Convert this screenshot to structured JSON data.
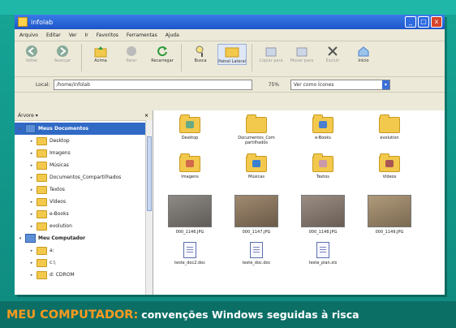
{
  "window": {
    "title": "infolab",
    "buttons": [
      "_",
      "□",
      "x"
    ]
  },
  "menubar": [
    "Arquivo",
    "Editar",
    "Ver",
    "Ir",
    "Favoritos",
    "Ferramentas",
    "Ajuda"
  ],
  "toolbar": [
    {
      "label": "Voltar",
      "icon": "back-arrow-icon",
      "dim": true
    },
    {
      "label": "Avançar",
      "icon": "forward-arrow-icon",
      "dim": true
    },
    {
      "label": "Acima",
      "icon": "up-folder-icon",
      "dim": false
    },
    {
      "label": "Parar",
      "icon": "stop-icon",
      "dim": true
    },
    {
      "label": "Recarregar",
      "icon": "reload-icon",
      "dim": false
    },
    {
      "label": "Busca",
      "icon": "search-icon",
      "dim": false
    },
    {
      "label": "Painel Lateral",
      "icon": "sidebar-icon",
      "dim": false
    },
    {
      "label": "Copiar para",
      "icon": "copy-icon",
      "dim": true
    },
    {
      "label": "Mover para",
      "icon": "move-icon",
      "dim": true
    },
    {
      "label": "Excluir",
      "icon": "delete-icon",
      "dim": true
    },
    {
      "label": "Início",
      "icon": "home-icon",
      "dim": false
    }
  ],
  "location": {
    "label": "Local:",
    "value": "/home/infolab",
    "zoom": "75%",
    "view": "Ver como Ícones"
  },
  "sidebar": {
    "title": "Árvore",
    "items": [
      {
        "label": "Meus Documentos",
        "indent": 0,
        "type": "pc",
        "selected": true
      },
      {
        "label": "Desktop",
        "indent": 1,
        "type": "folder"
      },
      {
        "label": "Imagens",
        "indent": 1,
        "type": "folder"
      },
      {
        "label": "Músicas",
        "indent": 1,
        "type": "folder"
      },
      {
        "label": "Documentos_Compartilhados",
        "indent": 1,
        "type": "folder"
      },
      {
        "label": "Textos",
        "indent": 1,
        "type": "folder"
      },
      {
        "label": "Vídeos",
        "indent": 1,
        "type": "folder"
      },
      {
        "label": "e-Books",
        "indent": 1,
        "type": "folder"
      },
      {
        "label": "evolution",
        "indent": 1,
        "type": "folder"
      },
      {
        "label": "Meu Computador",
        "indent": 0,
        "type": "pc"
      },
      {
        "label": "a:",
        "indent": 1,
        "type": "folder"
      },
      {
        "label": "c:\\",
        "indent": 1,
        "type": "folder"
      },
      {
        "label": "d: CDROM",
        "indent": 1,
        "type": "folder"
      }
    ]
  },
  "files": [
    {
      "label": "Desktop",
      "kind": "folder",
      "emblem": "#6a8"
    },
    {
      "label": "Documentos_Com partilhados",
      "kind": "folder",
      "emblem": ""
    },
    {
      "label": "e-Books",
      "kind": "folder",
      "emblem": "#4a7fd0"
    },
    {
      "label": "evolution",
      "kind": "folder",
      "emblem": ""
    },
    {
      "label": "Imagens",
      "kind": "folder",
      "emblem": "#d06a4a"
    },
    {
      "label": "Músicas",
      "kind": "folder",
      "emblem": "#3a7fd0"
    },
    {
      "label": "Textos",
      "kind": "folder",
      "emblem": "#c9a"
    },
    {
      "label": "Vídeos",
      "kind": "folder",
      "emblem": "#a55"
    },
    {
      "label": "000_1146.JPG",
      "kind": "photo",
      "colors": [
        "#8d8a86",
        "#5f5c58"
      ]
    },
    {
      "label": "000_1147.JPG",
      "kind": "photo",
      "colors": [
        "#a08a70",
        "#6b5a48"
      ]
    },
    {
      "label": "000_1148.JPG",
      "kind": "photo",
      "colors": [
        "#9a8e84",
        "#6a5e54"
      ]
    },
    {
      "label": "000_1149.JPG",
      "kind": "photo",
      "colors": [
        "#b09a7a",
        "#7a6a52"
      ]
    },
    {
      "label": "teste_doc2.doc",
      "kind": "doc"
    },
    {
      "label": "teste_doc.doc",
      "kind": "doc"
    },
    {
      "label": "teste_plan.xls",
      "kind": "doc"
    }
  ],
  "caption": {
    "lead": "MEU COMPUTADOR:",
    "text": "convenções Windows seguidas à risca"
  }
}
